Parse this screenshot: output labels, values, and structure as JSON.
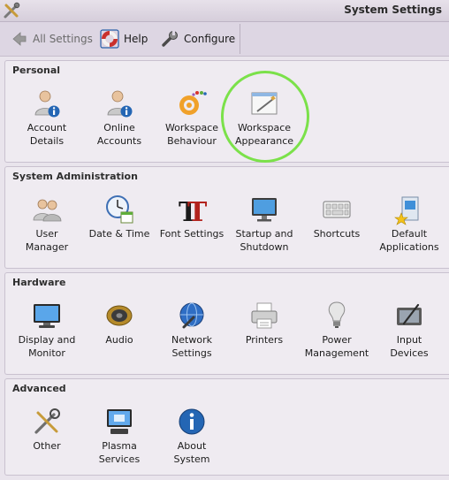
{
  "window": {
    "title": "System Settings"
  },
  "toolbar": {
    "back_label": "All Settings",
    "help_label": "Help",
    "configure_label": "Configure"
  },
  "sections": {
    "personal": {
      "title": "Personal",
      "items": [
        {
          "label": "Account\nDetails",
          "icon": "user-info-icon"
        },
        {
          "label": "Online\nAccounts",
          "icon": "user-info-icon"
        },
        {
          "label": "Workspace\nBehaviour",
          "icon": "workspace-behaviour-icon"
        },
        {
          "label": "Workspace\nAppearance",
          "icon": "workspace-appearance-icon"
        }
      ]
    },
    "system": {
      "title": "System Administration",
      "items": [
        {
          "label": "User\nManager",
          "icon": "users-icon"
        },
        {
          "label": "Date & Time",
          "icon": "clock-icon"
        },
        {
          "label": "Font Settings",
          "icon": "font-icon"
        },
        {
          "label": "Startup and\nShutdown",
          "icon": "monitor-icon"
        },
        {
          "label": "Shortcuts",
          "icon": "keyboard-icon"
        },
        {
          "label": "Default\nApplications",
          "icon": "default-apps-icon"
        }
      ]
    },
    "hardware": {
      "title": "Hardware",
      "items": [
        {
          "label": "Display and\nMonitor",
          "icon": "display-icon"
        },
        {
          "label": "Audio",
          "icon": "speaker-icon"
        },
        {
          "label": "Network\nSettings",
          "icon": "network-icon"
        },
        {
          "label": "Printers",
          "icon": "printer-icon"
        },
        {
          "label": "Power\nManagement",
          "icon": "bulb-icon"
        },
        {
          "label": "Input\nDevices",
          "icon": "tablet-icon"
        }
      ]
    },
    "advanced": {
      "title": "Advanced",
      "items": [
        {
          "label": "Other",
          "icon": "tools-icon"
        },
        {
          "label": "Plasma\nServices",
          "icon": "plasma-services-icon"
        },
        {
          "label": "About\nSystem",
          "icon": "info-icon"
        }
      ]
    }
  },
  "colors": {
    "highlight_ring": "#7be14a",
    "info_blue": "#2466b4"
  }
}
